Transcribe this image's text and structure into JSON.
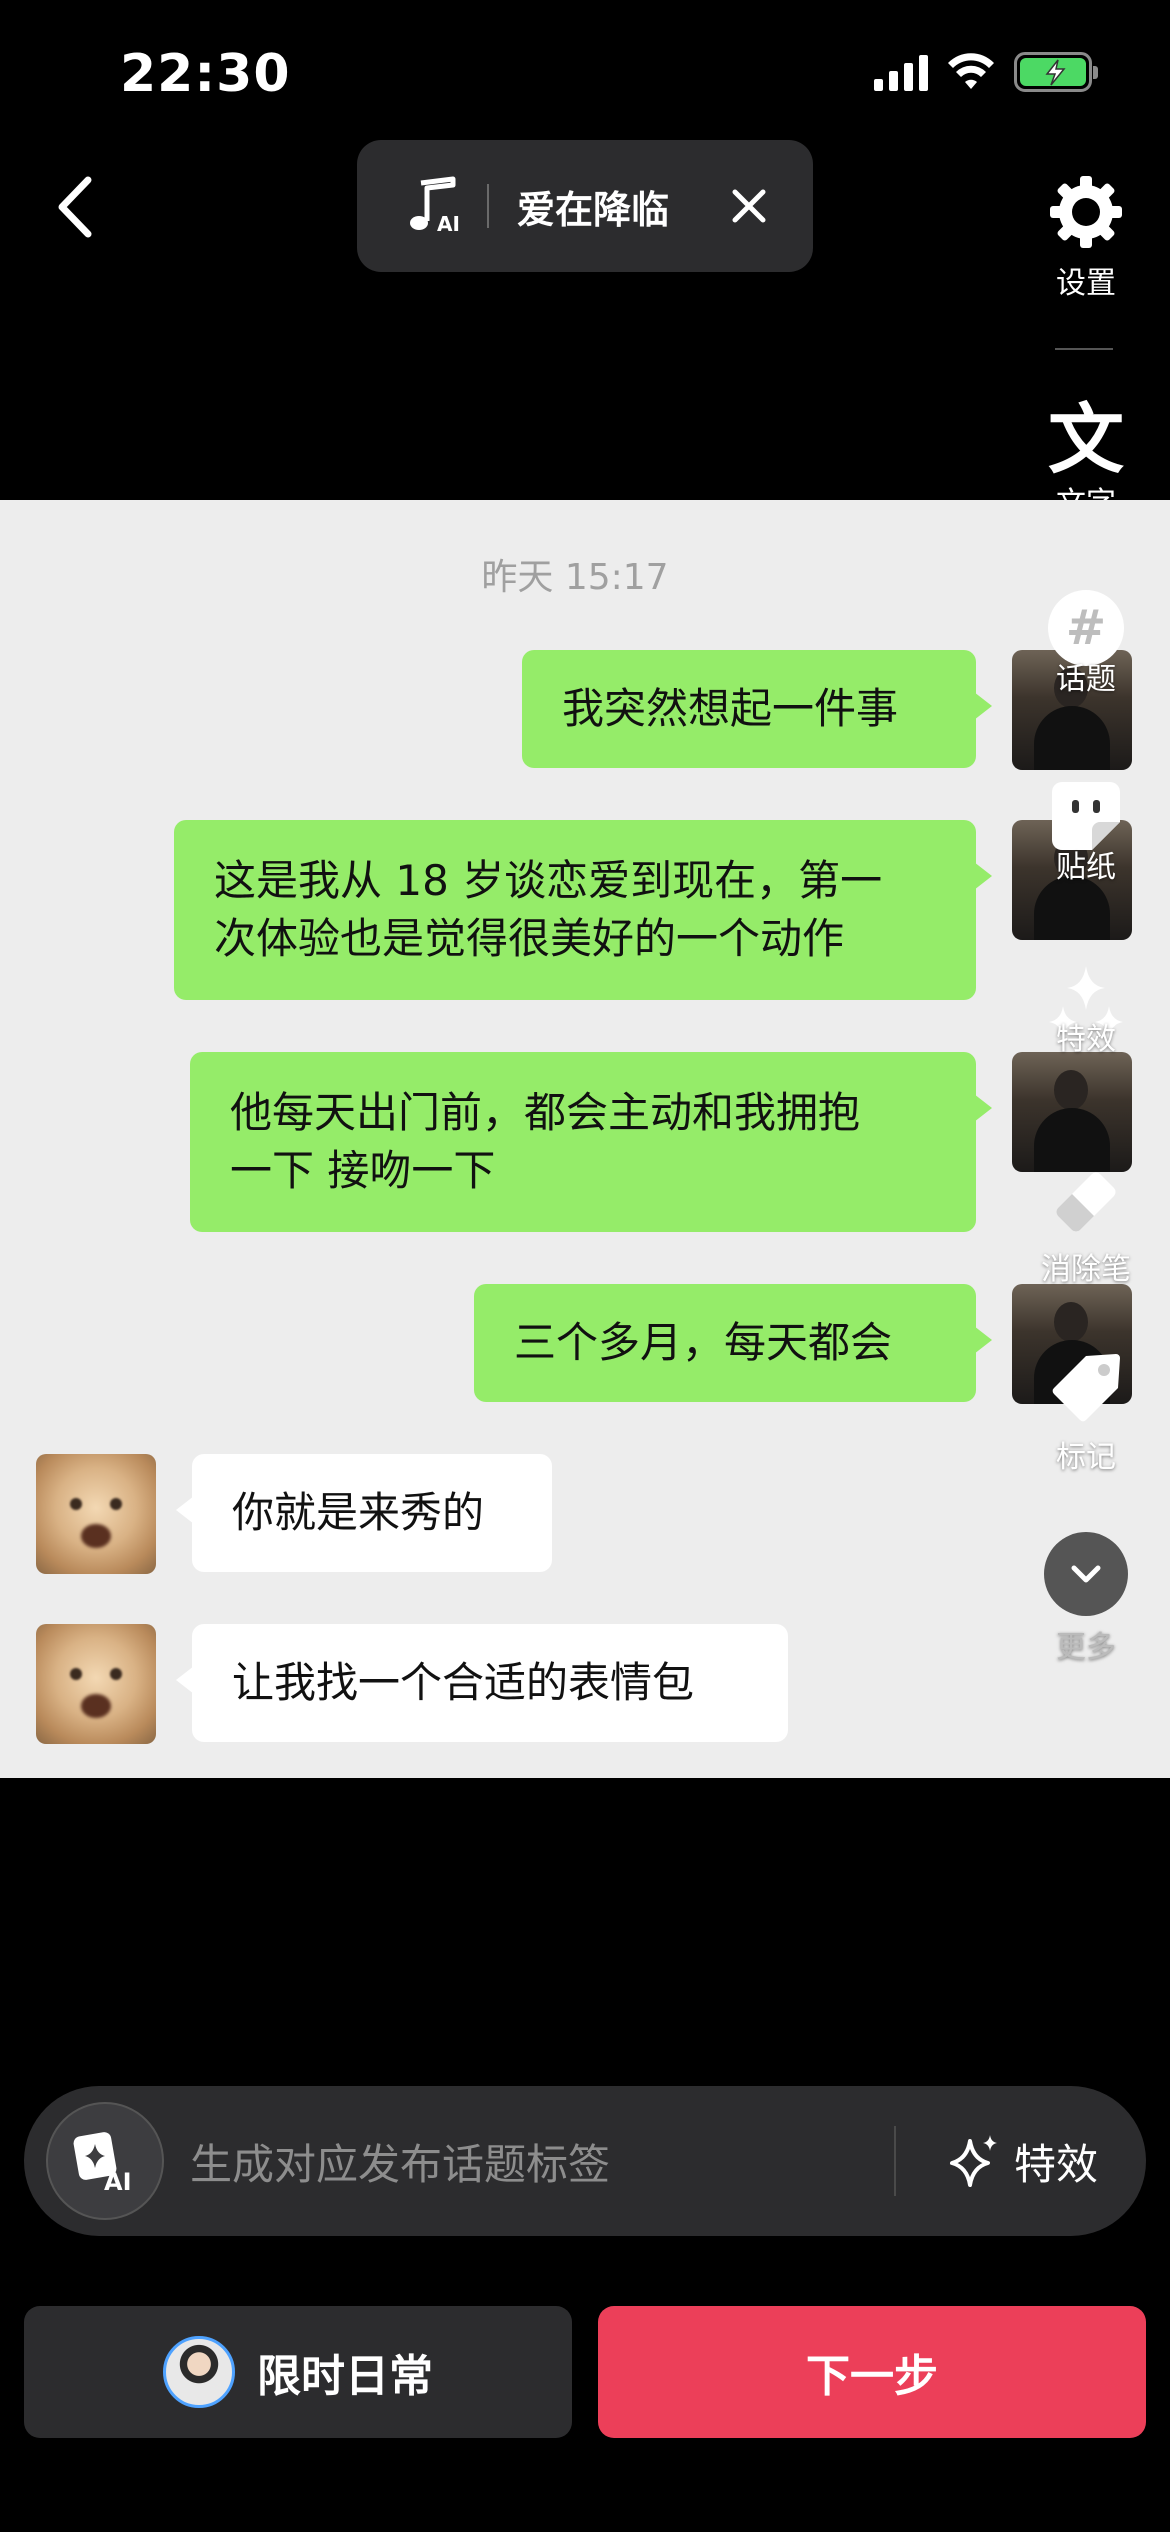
{
  "status_bar": {
    "time": "22:30"
  },
  "top_bar": {
    "song_title": "爱在降临",
    "music_icon_text": "AI"
  },
  "toolbar": [
    {
      "id": "settings",
      "label": "设置"
    },
    {
      "id": "text",
      "label": "文字"
    },
    {
      "id": "topic",
      "label": "话题"
    },
    {
      "id": "sticker",
      "label": "贴纸"
    },
    {
      "id": "effects",
      "label": "特效"
    },
    {
      "id": "eraser",
      "label": "消除笔"
    },
    {
      "id": "mark",
      "label": "标记"
    },
    {
      "id": "more",
      "label": "更多"
    }
  ],
  "chat": {
    "timestamp": "昨天 15:17",
    "messages": [
      {
        "from": "me",
        "lines": [
          "我突然想起一件事"
        ]
      },
      {
        "from": "me",
        "lines": [
          "这是我从 18 岁谈恋爱到现在，第一",
          "次体验也是觉得很美好的一个动作"
        ]
      },
      {
        "from": "me",
        "lines": [
          "他每天出门前，都会主动和我拥抱",
          "一下 接吻一下"
        ]
      },
      {
        "from": "me",
        "lines": [
          "三个多月，每天都会"
        ]
      },
      {
        "from": "other",
        "lines": [
          "你就是来秀的"
        ]
      },
      {
        "from": "other",
        "lines": [
          "让我找一个合适的表情包"
        ]
      }
    ]
  },
  "ai_bar": {
    "placeholder": "生成对应发布话题标签",
    "effect_label": "特效",
    "ai_icon_text": "AI"
  },
  "buttons": {
    "daily": "限时日常",
    "next": "下一步"
  },
  "colors": {
    "outgoing_bubble": "#95ec69",
    "incoming_bubble": "#ffffff",
    "next_button": "#ec3f59",
    "chat_background": "#ededed"
  },
  "icons": [
    "back-chevron-icon",
    "music-note-ai-icon",
    "close-icon",
    "gear-icon",
    "text-wen-icon",
    "hashtag-icon",
    "sticker-icon",
    "sparkles-icon",
    "eraser-icon",
    "tag-icon",
    "chevron-down-icon",
    "ai-sparkle-icon"
  ]
}
